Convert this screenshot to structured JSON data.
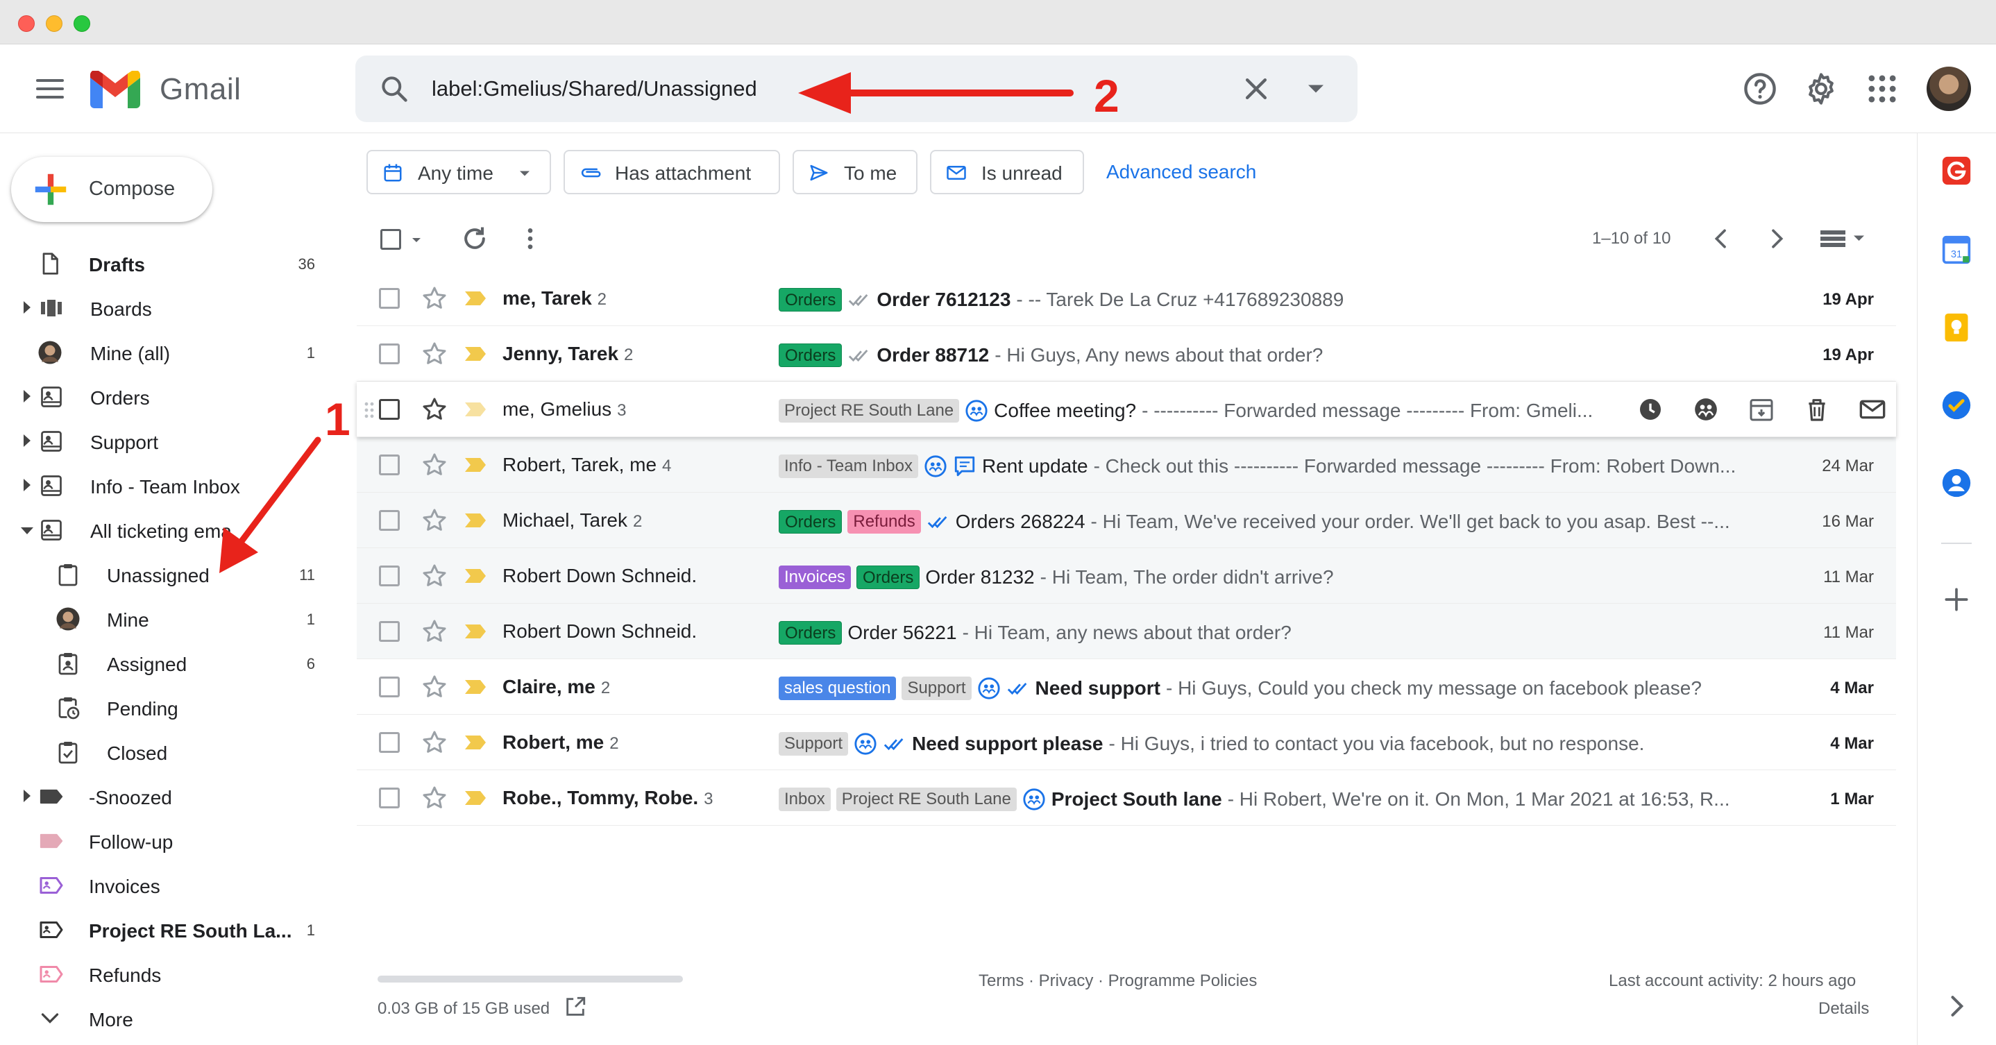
{
  "app": {
    "brand": "Gmail"
  },
  "search": {
    "query": "label:Gmelius/Shared/Unassigned"
  },
  "compose": {
    "label": "Compose"
  },
  "sidebar": {
    "items": [
      {
        "label": "Drafts",
        "count": "36",
        "bold": true
      },
      {
        "label": "Boards",
        "count": ""
      },
      {
        "label": "Mine (all)",
        "count": "1"
      },
      {
        "label": "Orders",
        "count": ""
      },
      {
        "label": "Support",
        "count": ""
      },
      {
        "label": "Info - Team Inbox",
        "count": ""
      },
      {
        "label": "All ticketing ema",
        "count": ""
      },
      {
        "label": "Unassigned",
        "count": "11"
      },
      {
        "label": "Mine",
        "count": "1"
      },
      {
        "label": "Assigned",
        "count": "6"
      },
      {
        "label": "Pending",
        "count": ""
      },
      {
        "label": "Closed",
        "count": ""
      },
      {
        "label": "-Snoozed",
        "count": ""
      },
      {
        "label": "Follow-up",
        "count": ""
      },
      {
        "label": "Invoices",
        "count": ""
      },
      {
        "label": "Project RE South La...",
        "count": "1",
        "bold": true
      },
      {
        "label": "Refunds",
        "count": ""
      },
      {
        "label": "More",
        "count": ""
      }
    ]
  },
  "filters": {
    "any_time": "Any time",
    "has_attachment": "Has attachment",
    "to_me": "To me",
    "is_unread": "Is unread",
    "advanced": "Advanced search"
  },
  "pager": {
    "range": "1–10 of 10"
  },
  "emails": [
    {
      "from": "me, Tarek",
      "n": "2",
      "tags": [
        "Orders"
      ],
      "subject": "Order 7612123",
      "snippet": " - -- Tarek De La Cruz +417689230889",
      "date": "19 Apr",
      "unread": true
    },
    {
      "from": "Jenny, Tarek",
      "n": "2",
      "tags": [
        "Orders"
      ],
      "subject": "Order 88712",
      "snippet": " - Hi Guys, Any news about that order?",
      "date": "19 Apr",
      "unread": true
    },
    {
      "from": "me, Gmelius",
      "n": "3",
      "tags": [
        "Project RE South Lane"
      ],
      "subject": "Coffee meeting?",
      "snippet": " - ---------- Forwarded message --------- From: Gmeli...",
      "date": "",
      "unread": false
    },
    {
      "from": "Robert, Tarek, me",
      "n": "4",
      "tags": [
        "Info - Team Inbox"
      ],
      "subject": "Rent update",
      "snippet": " - Check out this ---------- Forwarded message --------- From: Robert Down...",
      "date": "24 Mar",
      "unread": false
    },
    {
      "from": "Michael, Tarek",
      "n": "2",
      "tags": [
        "Orders",
        "Refunds"
      ],
      "subject": "Orders 268224",
      "snippet": " - Hi Team, We've received your order. We'll get back to you asap. Best --...",
      "date": "16 Mar",
      "unread": false
    },
    {
      "from": "Robert Down Schneid.",
      "n": "",
      "tags": [
        "Invoices",
        "Orders"
      ],
      "subject": "Order 81232",
      "snippet": " - Hi Team, The order didn't arrive?",
      "date": "11 Mar",
      "unread": false
    },
    {
      "from": "Robert Down Schneid.",
      "n": "",
      "tags": [
        "Orders"
      ],
      "subject": "Order 56221",
      "snippet": " - Hi Team, any news about that order?",
      "date": "11 Mar",
      "unread": false
    },
    {
      "from": "Claire, me",
      "n": "2",
      "tags": [
        "sales question",
        "Support"
      ],
      "subject": "Need support",
      "snippet": " - Hi Guys, Could you check my message on facebook please?",
      "date": "4 Mar",
      "unread": true
    },
    {
      "from": "Robert, me",
      "n": "2",
      "tags": [
        "Support"
      ],
      "subject": "Need support please",
      "snippet": " - Hi Guys, i tried to contact you via facebook, but no response.",
      "date": "4 Mar",
      "unread": true
    },
    {
      "from": "Robe., Tommy, Robe.",
      "n": "3",
      "tags": [
        "Inbox",
        "Project RE South Lane"
      ],
      "subject": "Project South lane",
      "snippet": " - Hi Robert, We're on it. On Mon, 1 Mar 2021 at 16:53, R...",
      "date": "1 Mar",
      "unread": true
    }
  ],
  "footer": {
    "storage": "0.03 GB of 15 GB used",
    "links": "Terms · Privacy · Programme Policies",
    "activity": "Last account activity: 2 hours ago",
    "details": "Details"
  },
  "annotations": {
    "one": "1",
    "two": "2"
  },
  "colors": {
    "accent": "#1a73e8",
    "arrow": "#e8231b",
    "orders": "#16a765",
    "refunds": "#f691b2",
    "invoices": "#9a60d6",
    "sales": "#4a86e8"
  }
}
